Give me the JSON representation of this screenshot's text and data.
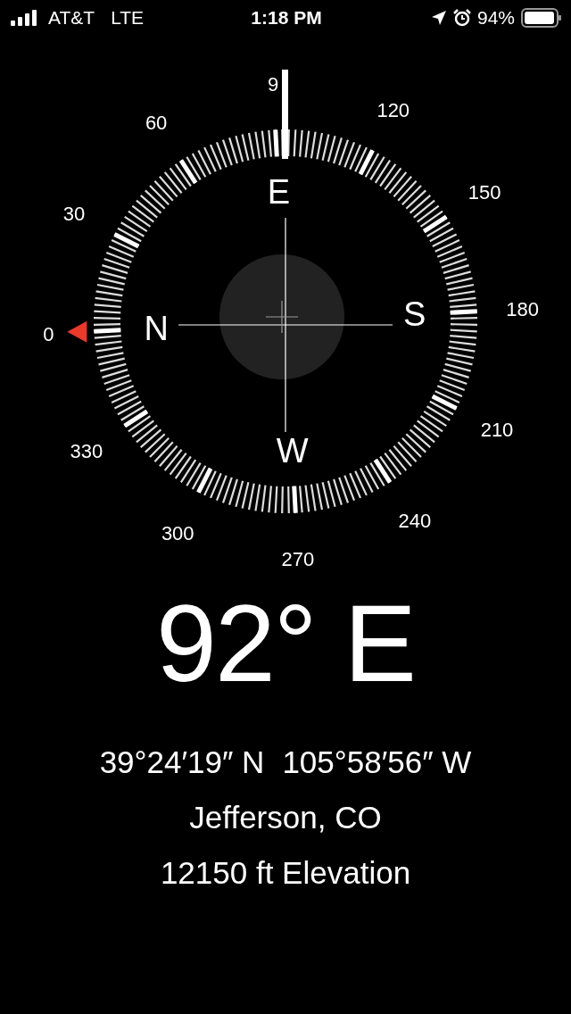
{
  "status_bar": {
    "carrier": "AT&T",
    "network": "LTE",
    "time": "1:18 PM",
    "battery": "94%"
  },
  "compass": {
    "degree_labels": [
      "0",
      "30",
      "60",
      "9",
      "120",
      "150",
      "180",
      "210",
      "240",
      "270",
      "300",
      "330"
    ],
    "cardinals": [
      "N",
      "E",
      "S",
      "W"
    ]
  },
  "heading": "92° E",
  "coordinates": {
    "latitude": "39°24′19″ N",
    "longitude": "105°58′56″ W"
  },
  "location": "Jefferson, CO",
  "elevation": "12150 ft Elevation"
}
